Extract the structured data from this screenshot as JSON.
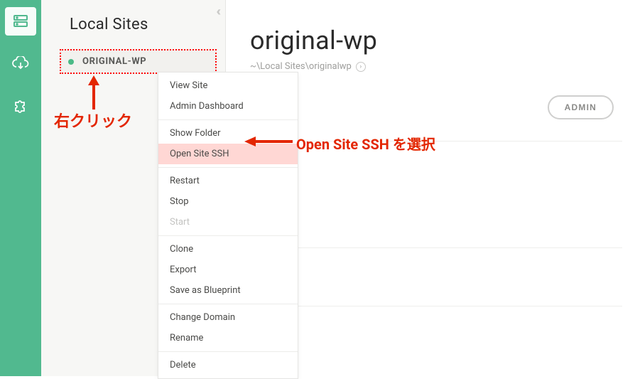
{
  "iconbar": {
    "items": [
      "sites",
      "cloud",
      "addons"
    ],
    "activeIndex": 0
  },
  "sidebar": {
    "title": "Local Sites",
    "sites": [
      {
        "name": "ORIGINAL-WP",
        "status": "running"
      }
    ]
  },
  "main": {
    "title": "original-wp",
    "path": "~\\Local Sites\\originalwp",
    "admin_button": "ADMIN"
  },
  "context_menu": {
    "groups": [
      [
        {
          "label": "View Site",
          "enabled": true
        },
        {
          "label": "Admin Dashboard",
          "enabled": true
        }
      ],
      [
        {
          "label": "Show Folder",
          "enabled": true
        },
        {
          "label": "Open Site SSH",
          "enabled": true,
          "highlight": true
        }
      ],
      [
        {
          "label": "Restart",
          "enabled": true
        },
        {
          "label": "Stop",
          "enabled": true
        },
        {
          "label": "Start",
          "enabled": false
        }
      ],
      [
        {
          "label": "Clone",
          "enabled": true
        },
        {
          "label": "Export",
          "enabled": true
        },
        {
          "label": "Save as Blueprint",
          "enabled": true
        }
      ],
      [
        {
          "label": "Change Domain",
          "enabled": true
        },
        {
          "label": "Rename",
          "enabled": true
        }
      ],
      [
        {
          "label": "Delete",
          "enabled": true
        }
      ]
    ]
  },
  "annotations": {
    "right_click": "右クリック",
    "select_ssh": "Open Site SSH を選択"
  },
  "colors": {
    "accent": "#51b98f",
    "annotation": "#e32600",
    "highlight_bg": "#ffd7d4"
  }
}
